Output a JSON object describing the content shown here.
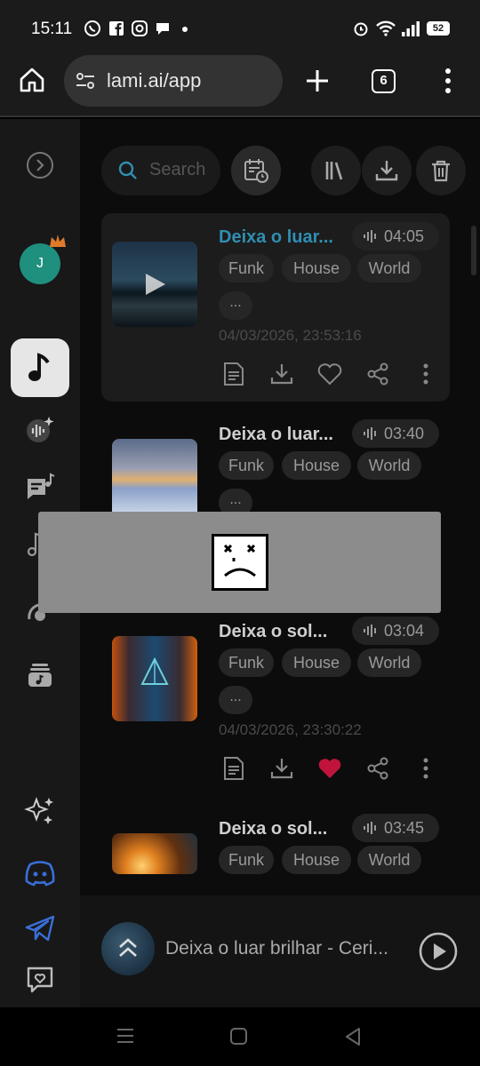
{
  "status_bar": {
    "time": "15:11",
    "battery": "52",
    "notification_icons": [
      "whatsapp-icon",
      "facebook-icon",
      "instagram-icon",
      "chat-bubble-icon",
      "dot-icon"
    ],
    "system_icons": [
      "alarm-icon",
      "wifi-icon",
      "signal-icon",
      "battery-icon"
    ]
  },
  "browser": {
    "url": "lami.ai/app",
    "tab_count": "6"
  },
  "sidebar": {
    "avatar_initial": "J"
  },
  "toolbar": {
    "search_placeholder": "Search"
  },
  "songs": [
    {
      "title": "Deixa o luar...",
      "duration": "04:05",
      "tags": [
        "Funk",
        "House",
        "World"
      ],
      "more": "...",
      "date": "04/03/2026, 23:53:16",
      "liked": false,
      "active": true
    },
    {
      "title": "Deixa o luar...",
      "duration": "03:40",
      "tags": [
        "Funk",
        "House",
        "World"
      ],
      "more": "...",
      "date": "",
      "liked": false,
      "active": false
    },
    {
      "title": "Deixa o sol...",
      "duration": "03:04",
      "tags": [
        "Funk",
        "House",
        "World"
      ],
      "more": "...",
      "date": "04/03/2026, 23:30:22",
      "liked": true,
      "active": false
    },
    {
      "title": "Deixa o sol...",
      "duration": "03:45",
      "tags": [
        "Funk",
        "House",
        "World"
      ],
      "more": "",
      "date": "",
      "liked": false,
      "active": false
    }
  ],
  "player": {
    "title": "Deixa o luar brilhar - Ceri..."
  },
  "colors": {
    "accent": "#2f8fb2",
    "like": "#c0143c",
    "discord": "#3a6fd8"
  }
}
